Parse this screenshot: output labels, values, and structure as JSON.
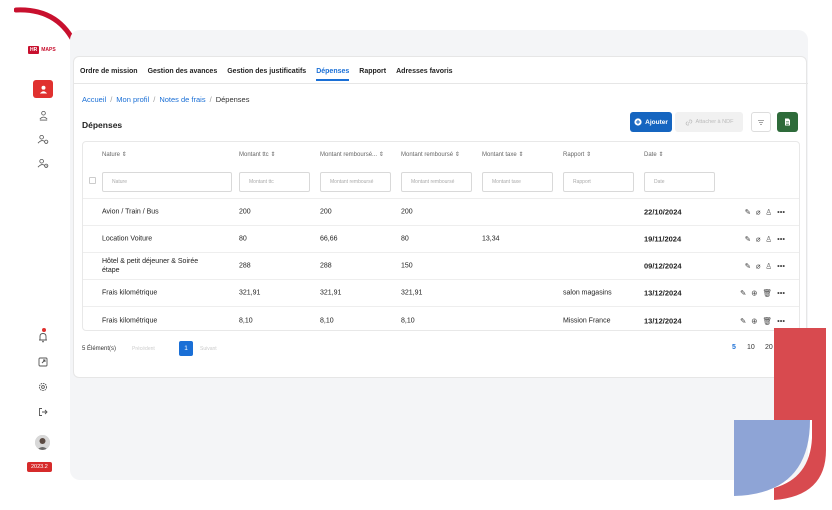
{
  "brand": {
    "box_text": "HR",
    "logo_text": "MAPS"
  },
  "sidebar": {
    "items": [
      {
        "icon": "user-icon",
        "active": true
      },
      {
        "icon": "user-money-icon"
      },
      {
        "icon": "user-gear-icon"
      },
      {
        "icon": "user-group-icon"
      }
    ],
    "bottom": [
      {
        "icon": "bell-icon"
      },
      {
        "icon": "external-link-icon"
      },
      {
        "icon": "settings-icon"
      },
      {
        "icon": "logout-icon"
      }
    ],
    "version": "2023.2"
  },
  "tabs": [
    {
      "label": "Ordre de mission"
    },
    {
      "label": "Gestion des avances"
    },
    {
      "label": "Gestion des justificatifs"
    },
    {
      "label": "Dépenses",
      "active": true
    },
    {
      "label": "Rapport"
    },
    {
      "label": "Adresses favoris"
    }
  ],
  "breadcrumb": [
    "Accueil",
    "Mon profil",
    "Notes de frais",
    "Dépenses"
  ],
  "page_title": "Dépenses",
  "toolbar": {
    "add_label": "Ajouter",
    "attach_label": "Attacher à NDF"
  },
  "table": {
    "headers": [
      "Nature",
      "Montant ttc",
      "Montant remboursé...",
      "Montant remboursé",
      "Montant taxe",
      "Rapport",
      "Date"
    ],
    "placeholders": [
      "Nature",
      "Montant ttc",
      "Montant remboursé",
      "Montant remboursé",
      "Montant taxe",
      "Rapport",
      "Date"
    ],
    "rows": [
      {
        "nature": "Avion / Train / Bus",
        "ttc": "200",
        "remb1": "200",
        "remb2": "200",
        "taxe": "",
        "rapport": "",
        "date": "22/10/2024"
      },
      {
        "nature": "Location Voiture",
        "ttc": "80",
        "remb1": "66,66",
        "remb2": "80",
        "taxe": "13,34",
        "rapport": "",
        "date": "19/11/2024"
      },
      {
        "nature": "Hôtel & petit déjeuner & Soirée étape",
        "ttc": "288",
        "remb1": "288",
        "remb2": "150",
        "taxe": "",
        "rapport": "",
        "date": "09/12/2024"
      },
      {
        "nature": "Frais kilométrique",
        "ttc": "321,91",
        "remb1": "321,91",
        "remb2": "321,91",
        "taxe": "",
        "rapport": "salon magasins",
        "date": "13/12/2024"
      },
      {
        "nature": "Frais kilométrique",
        "ttc": "8,10",
        "remb1": "8,10",
        "remb2": "8,10",
        "taxe": "",
        "rapport": "Mission France",
        "date": "13/12/2024"
      }
    ]
  },
  "pagination": {
    "count_label": "5 Élément(s)",
    "prev_label": "Précédent",
    "current": "1",
    "next_label": "Suivant",
    "sizes": [
      "5",
      "10",
      "20"
    ]
  },
  "colors": {
    "accent": "#1a6fd6",
    "brand_red": "#c8102e",
    "export_green": "#2e6b3a"
  }
}
